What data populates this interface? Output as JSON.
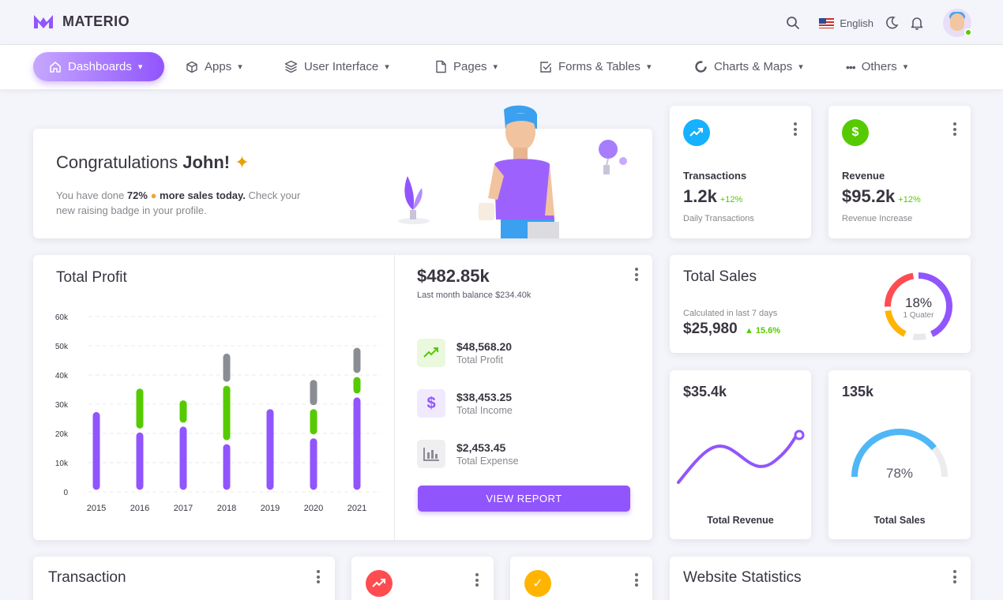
{
  "app": {
    "name": "MATERIO"
  },
  "topbar": {
    "language": "English",
    "colors": {
      "accent": "#9155fd",
      "success": "#56ca00"
    }
  },
  "nav": [
    {
      "label": "Dashboards",
      "icon": "home-icon",
      "active": true
    },
    {
      "label": "Apps",
      "icon": "box-icon"
    },
    {
      "label": "User Interface",
      "icon": "layers-icon"
    },
    {
      "label": "Pages",
      "icon": "page-icon"
    },
    {
      "label": "Forms & Tables",
      "icon": "checkbox-icon"
    },
    {
      "label": "Charts & Maps",
      "icon": "donut-icon"
    },
    {
      "label": "Others",
      "icon": "more-dots-icon"
    }
  ],
  "congrats": {
    "title": "Congratulations",
    "name": "John!",
    "line1_pre": "You have done",
    "percent": "72%",
    "line1_bold": "more sales today.",
    "line1_post": "Check your",
    "line2": "new raising badge in your profile."
  },
  "transactions_card": {
    "label": "Transactions",
    "value": "1.2k",
    "change": "+12%",
    "sub": "Daily Transactions"
  },
  "revenue_card": {
    "label": "Revenue",
    "value": "$95.2k",
    "change": "+12%",
    "sub": "Revenue Increase"
  },
  "total_profit": {
    "title": "Total Profit"
  },
  "chart_data": {
    "type": "bar",
    "stacked": true,
    "categories": [
      "2015",
      "2016",
      "2017",
      "2018",
      "2019",
      "2020",
      "2021"
    ],
    "series": [
      {
        "color": "#9155fd",
        "values": [
          28,
          21,
          23,
          17,
          29,
          19,
          33
        ]
      },
      {
        "color": "#56ca00",
        "values": [
          0,
          15,
          9,
          20,
          0,
          10,
          7
        ]
      },
      {
        "color": "#8a8d93",
        "values": [
          0,
          0,
          0,
          11,
          0,
          10,
          10
        ]
      }
    ],
    "ylim": [
      0,
      60
    ],
    "yticks": [
      "0",
      "10k",
      "20k",
      "30k",
      "40k",
      "50k",
      "60k"
    ],
    "grid": true
  },
  "balance": {
    "value": "$482.85k",
    "sub": "Last month balance $234.40k"
  },
  "profit_items": [
    {
      "amount": "$48,568.20",
      "label": "Total Profit",
      "icon": "trending-up-icon"
    },
    {
      "amount": "$38,453.25",
      "label": "Total Income",
      "icon": "dollar-icon"
    },
    {
      "amount": "$2,453.45",
      "label": "Total Expense",
      "icon": "bar-chart-icon"
    }
  ],
  "view_report": "VIEW REPORT",
  "total_sales": {
    "title": "Total Sales",
    "sub": "Calculated in last 7 days",
    "value": "$25,980",
    "change": "15.6%",
    "donut_value": "18%",
    "donut_label": "1 Quater"
  },
  "revenue_line": {
    "value": "$35.4k",
    "label": "Total Revenue"
  },
  "sales_gauge": {
    "value": "135k",
    "percent": "78%",
    "label": "Total Sales",
    "fraction": 0.78
  },
  "transaction": {
    "title": "Transaction"
  },
  "website_stats": {
    "title": "Website Statistics"
  }
}
